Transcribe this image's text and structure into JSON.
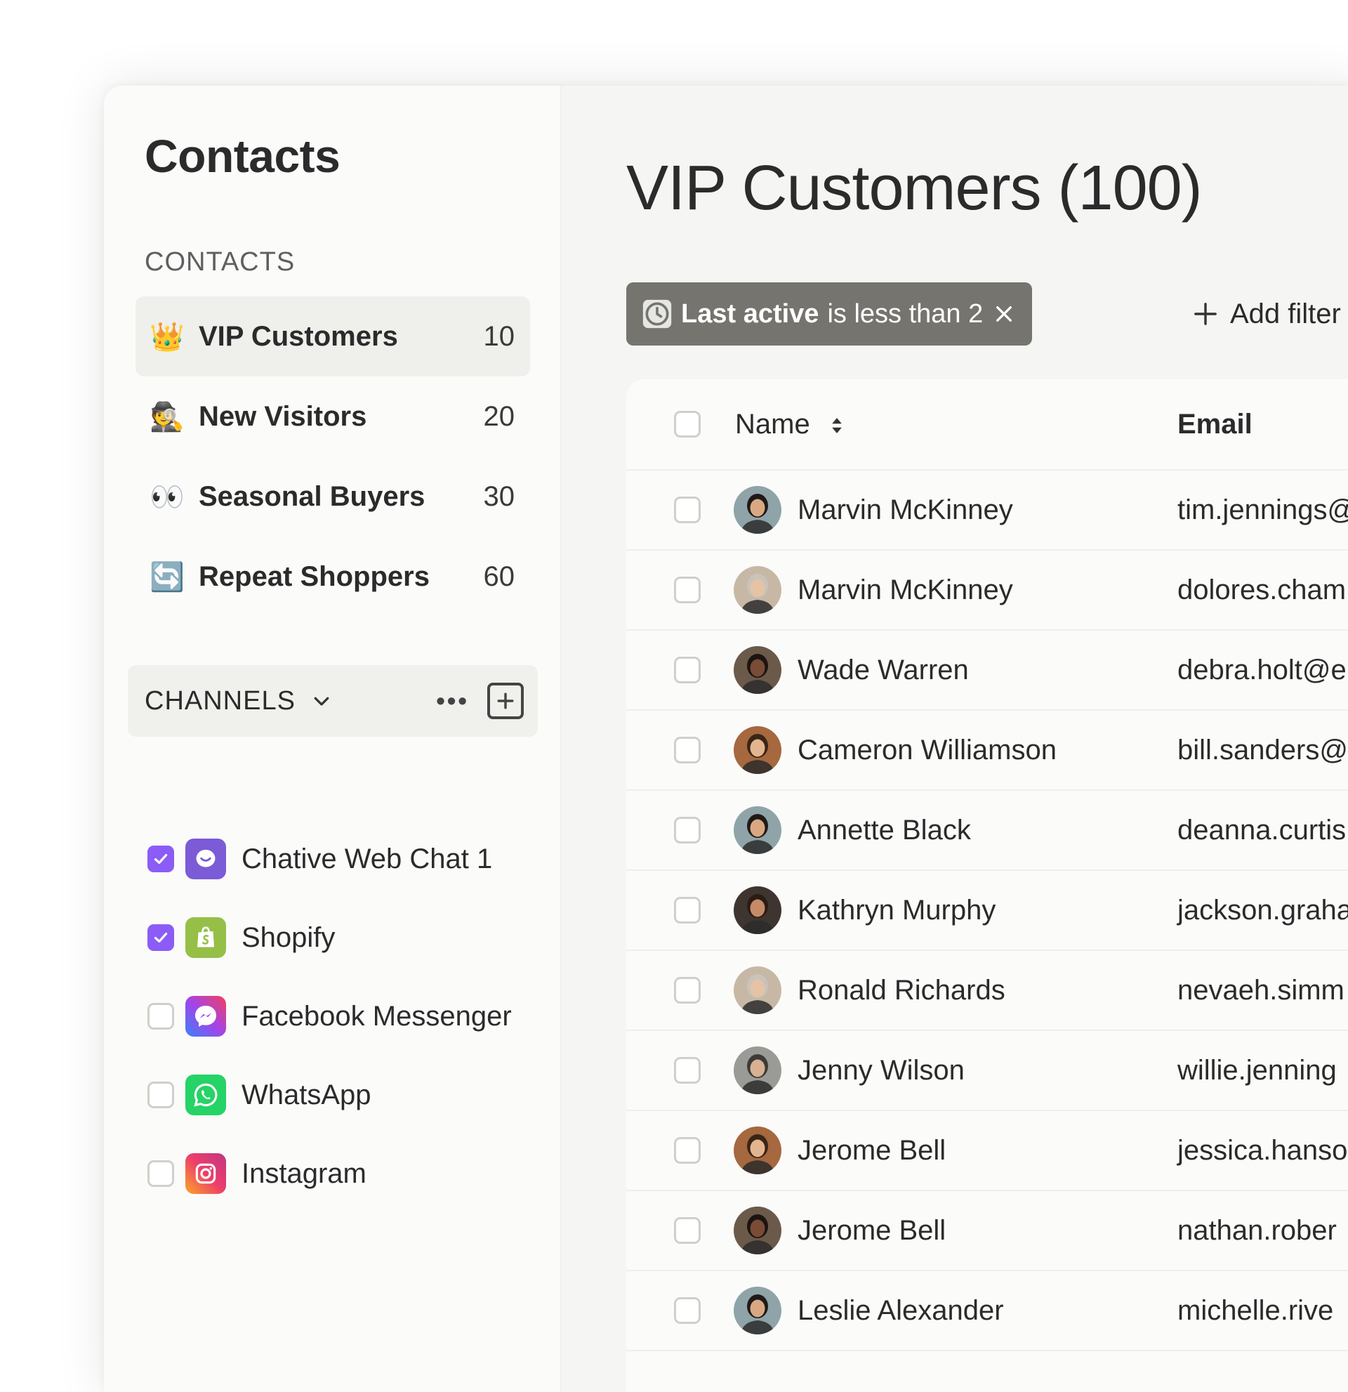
{
  "sidebar": {
    "title": "Contacts",
    "section_label": "CONTACTS",
    "segments": [
      {
        "emoji": "👑",
        "label": "VIP Customers",
        "count": "10"
      },
      {
        "emoji": "🕵️",
        "label": "New Visitors",
        "count": "20"
      },
      {
        "emoji": "👀",
        "label": "Seasonal Buyers",
        "count": "30"
      },
      {
        "emoji": "🔄",
        "label": "Repeat Shoppers",
        "count": "60"
      }
    ],
    "channels_title": "CHANNELS",
    "channels_more": "•••",
    "channels": [
      {
        "label": "Chative Web Chat 1",
        "checked": true,
        "icon": "chat-bubble-icon",
        "color": "#7b5bd6"
      },
      {
        "label": "Shopify",
        "checked": true,
        "icon": "shopify-bag-icon",
        "color": "#95bf47"
      },
      {
        "label": "Facebook Messenger",
        "checked": false,
        "icon": "messenger-icon",
        "color": "#a344e9"
      },
      {
        "label": "WhatsApp",
        "checked": false,
        "icon": "whatsapp-icon",
        "color": "#25d366"
      },
      {
        "label": "Instagram",
        "checked": false,
        "icon": "instagram-icon",
        "color": "#ee3e6a"
      }
    ]
  },
  "main": {
    "title": "VIP Customers (100)",
    "filter": {
      "field": "Last active",
      "rest": "is less than 2"
    },
    "add_filter": "Add filter",
    "columns": {
      "name": "Name",
      "email": "Email"
    },
    "rows": [
      {
        "name": "Marvin McKinney",
        "email": "tim.jennings@"
      },
      {
        "name": "Marvin McKinney",
        "email": "dolores.cham"
      },
      {
        "name": "Wade Warren",
        "email": "debra.holt@e"
      },
      {
        "name": "Cameron Williamson",
        "email": "bill.sanders@"
      },
      {
        "name": "Annette Black",
        "email": "deanna.curtis"
      },
      {
        "name": "Kathryn Murphy",
        "email": "jackson.graha"
      },
      {
        "name": "Ronald Richards",
        "email": "nevaeh.simm"
      },
      {
        "name": "Jenny Wilson",
        "email": "willie.jenning"
      },
      {
        "name": "Jerome Bell",
        "email": "jessica.hanso"
      },
      {
        "name": "Jerome Bell",
        "email": "nathan.rober"
      },
      {
        "name": "Leslie Alexander",
        "email": "michelle.rive"
      }
    ]
  },
  "colors": {
    "accent": "#8b5cf6",
    "chip": "#75746f",
    "active_bg": "#efefec"
  }
}
